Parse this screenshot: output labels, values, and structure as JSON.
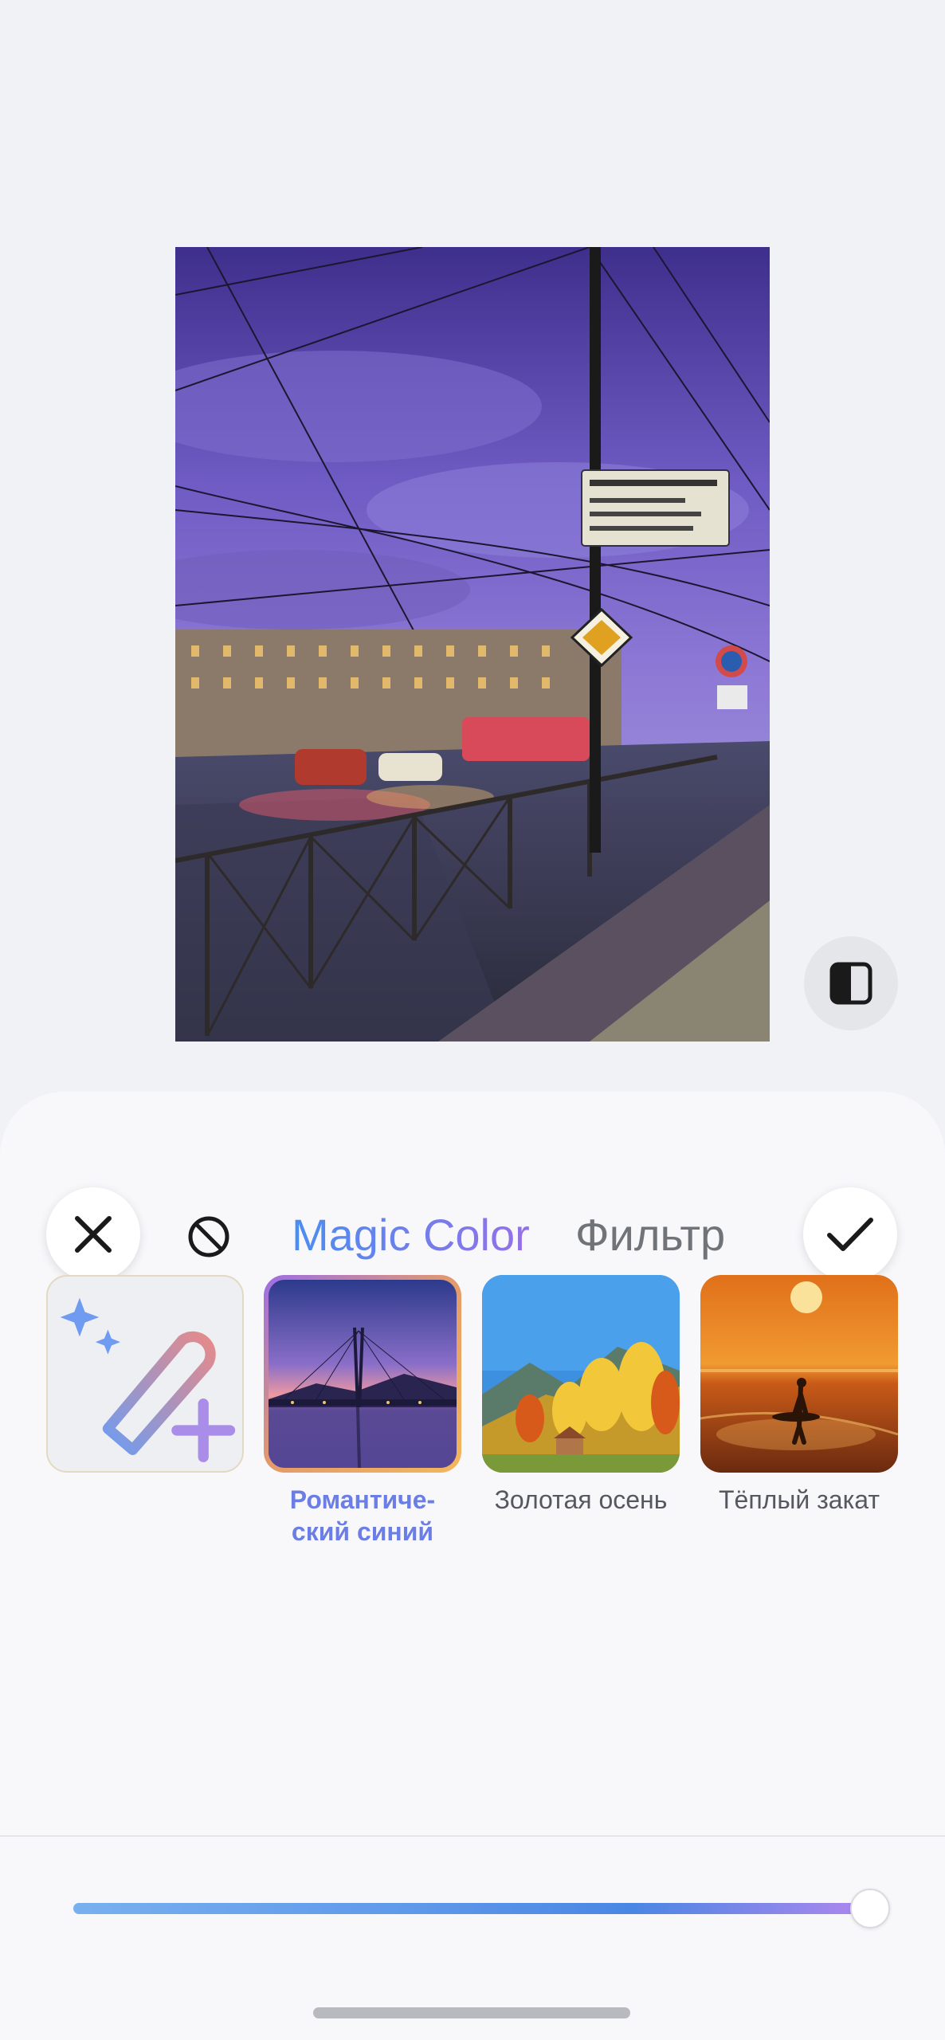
{
  "editor": {
    "title_tab_active": "Magic Color",
    "title_tab_other": "Фильтр"
  },
  "presets": [
    {
      "label": "",
      "icon": "magic-wand-plus-icon",
      "selected": false
    },
    {
      "label": "Романтиче-\nский синий",
      "selected": true
    },
    {
      "label": "Золотая осень",
      "selected": false
    },
    {
      "label": "Тёплый закат",
      "selected": false
    }
  ],
  "slider": {
    "value": 1.0
  },
  "colors": {
    "accent_start": "#4a8ef0",
    "accent_end": "#9b6ee6",
    "selected_label": "#6b7ee6"
  }
}
